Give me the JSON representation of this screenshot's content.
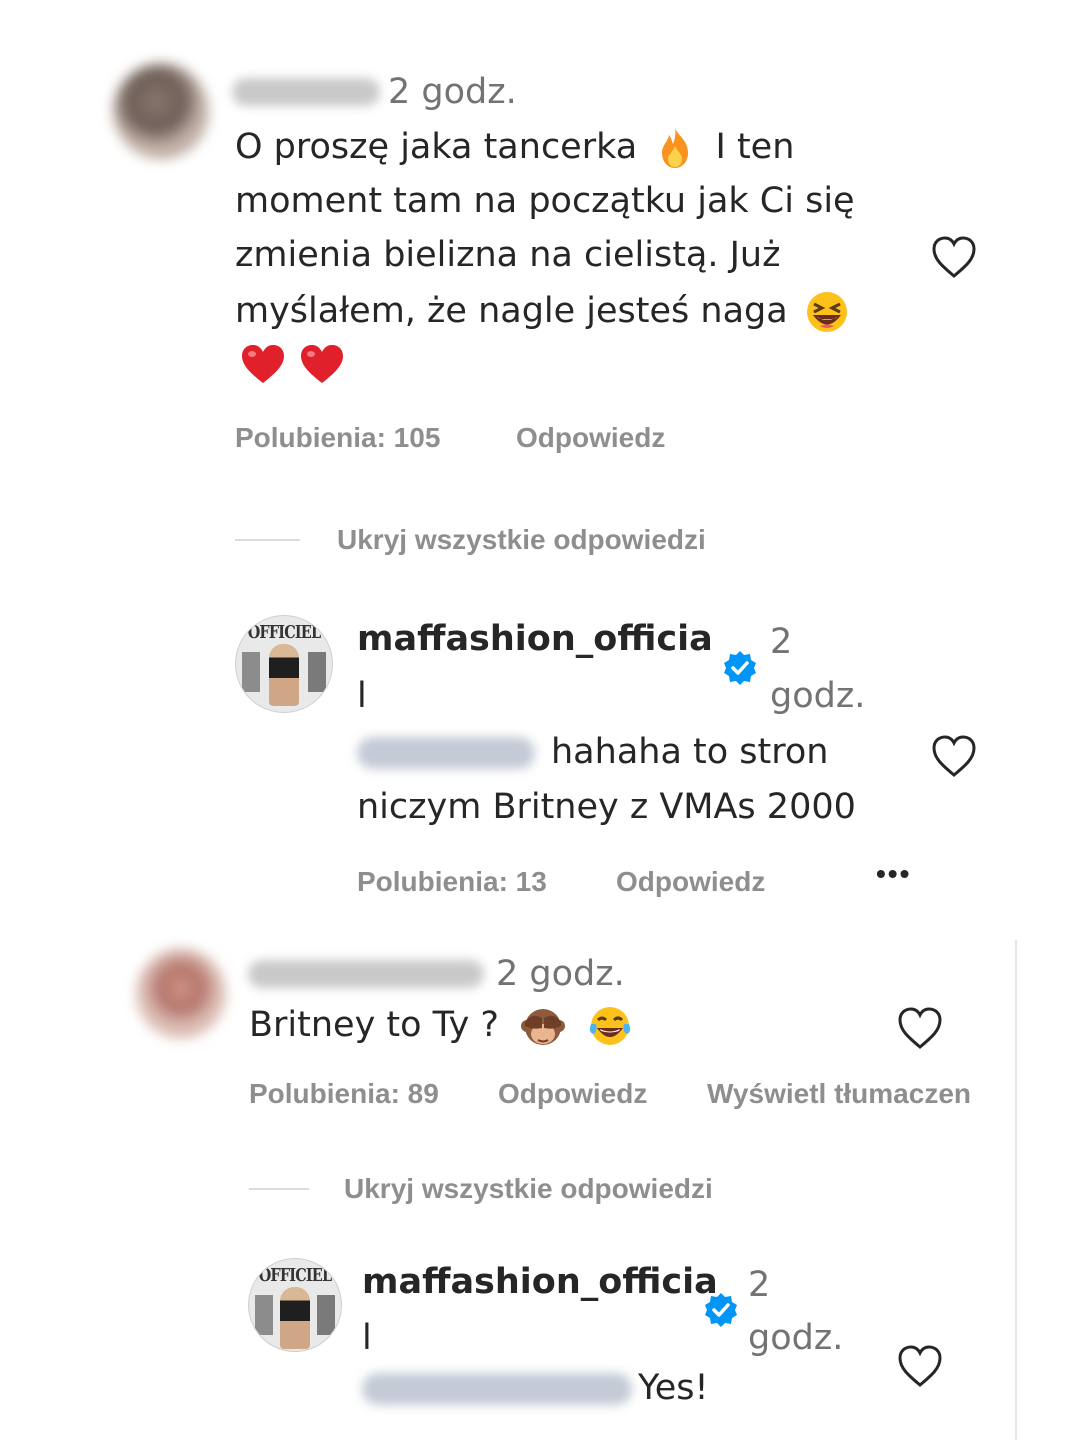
{
  "comments": [
    {
      "time": "2 godz.",
      "text_lines": [
        "O proszę jaka tancerka",
        "I ten",
        "moment tam na początku jak Ci się",
        "zmienia bielizna na cielistą. Już",
        "myślałem, że nagle jesteś naga"
      ],
      "likes": "Polubienia: 105",
      "reply": "Odpowiedz",
      "hide_replies": "Ukryj wszystkie odpowiedzi",
      "emojis": [
        "fire-emoji",
        "grinning-squinting-emoji",
        "red-heart-emoji",
        "red-heart-emoji"
      ]
    },
    {
      "username": "maffashion_officia",
      "username_tail": "l",
      "time_value": "2",
      "time_unit": "godz.",
      "text_lines": [
        "hahaha to stron",
        "niczym Britney z VMAs 2000"
      ],
      "likes": "Polubienia: 13",
      "reply": "Odpowiedz",
      "more": "•••"
    },
    {
      "time": "2 godz.",
      "text": "Britney to Ty ?",
      "likes": "Polubienia: 89",
      "reply": "Odpowiedz",
      "translate": "Wyświetl tłumaczen",
      "hide_replies": "Ukryj wszystkie odpowiedzi",
      "emojis": [
        "see-no-evil-monkey-emoji",
        "tears-of-joy-emoji"
      ]
    },
    {
      "username": "maffashion_officia",
      "username_tail": "l",
      "time_value": "2",
      "time_unit": "godz.",
      "text": "Yes!"
    }
  ],
  "brand_avatar_text": "OFFICIEL",
  "colors": {
    "text": "#262626",
    "meta": "#8e8e8e",
    "verified": "#0095f6",
    "heart_emoji": "#e0202a"
  }
}
